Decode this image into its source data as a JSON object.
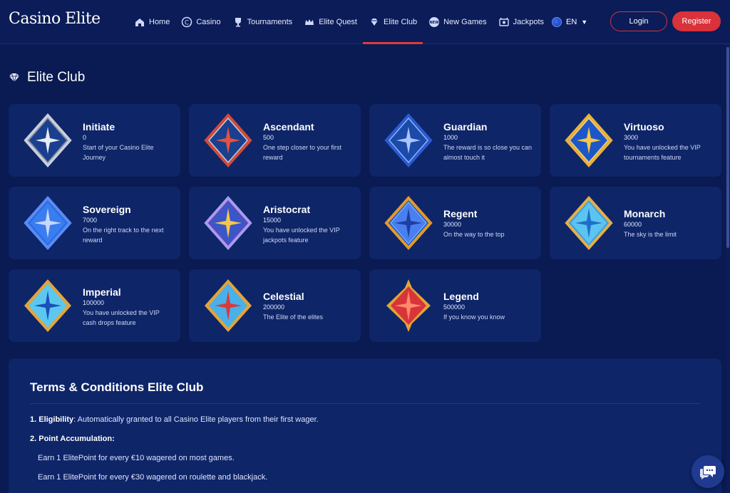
{
  "brand": {
    "logo_text": "Casino Elite"
  },
  "nav": [
    {
      "label": "Home",
      "icon": "home-icon"
    },
    {
      "label": "Casino",
      "icon": "casino-chip-icon"
    },
    {
      "label": "Tournaments",
      "icon": "trophy-icon"
    },
    {
      "label": "Elite Quest",
      "icon": "crown-icon"
    },
    {
      "label": "Elite Club",
      "icon": "diamond-icon",
      "active": true
    },
    {
      "label": "New Games",
      "icon": "new-badge-icon"
    },
    {
      "label": "Jackpots",
      "icon": "jackpot-icon"
    }
  ],
  "header": {
    "language": "EN",
    "login_label": "Login",
    "register_label": "Register"
  },
  "page": {
    "title": "Elite Club"
  },
  "tiers": [
    {
      "name": "Initiate",
      "points": "0",
      "description": "Start of your Casino Elite Journey"
    },
    {
      "name": "Ascendant",
      "points": "500",
      "description": "One step closer to your first reward"
    },
    {
      "name": "Guardian",
      "points": "1000",
      "description": "The reward is so close you can almost touch it"
    },
    {
      "name": "Virtuoso",
      "points": "3000",
      "description": "You have unlocked the VIP tournaments feature"
    },
    {
      "name": "Sovereign",
      "points": "7000",
      "description": "On the right track to the next reward"
    },
    {
      "name": "Aristocrat",
      "points": "15000",
      "description": "You have unlocked the VIP jackpots feature"
    },
    {
      "name": "Regent",
      "points": "30000",
      "description": "On the way to the top"
    },
    {
      "name": "Monarch",
      "points": "60000",
      "description": "The sky is the limit"
    },
    {
      "name": "Imperial",
      "points": "100000",
      "description": "You have unlocked the VIP cash drops feature"
    },
    {
      "name": "Celestial",
      "points": "200000",
      "description": "The Elite of the elites"
    },
    {
      "name": "Legend",
      "points": "500000",
      "description": "If you know you know"
    }
  ],
  "terms": {
    "title": "Terms & Conditions Elite Club",
    "eligibility_label": "1. Eligibility",
    "eligibility_text": ": Automatically granted to all Casino Elite players from their first wager.",
    "points_label": "2. Point Accumulation:",
    "points_rule_1": "Earn 1 ElitePoint for every €10 wagered on most games.",
    "points_rule_2": "Earn 1 ElitePoint for every €30 wagered on roulette and blackjack."
  },
  "colors": {
    "background": "#0a1a52",
    "card": "#0e2568",
    "accent_red": "#d9323a"
  }
}
